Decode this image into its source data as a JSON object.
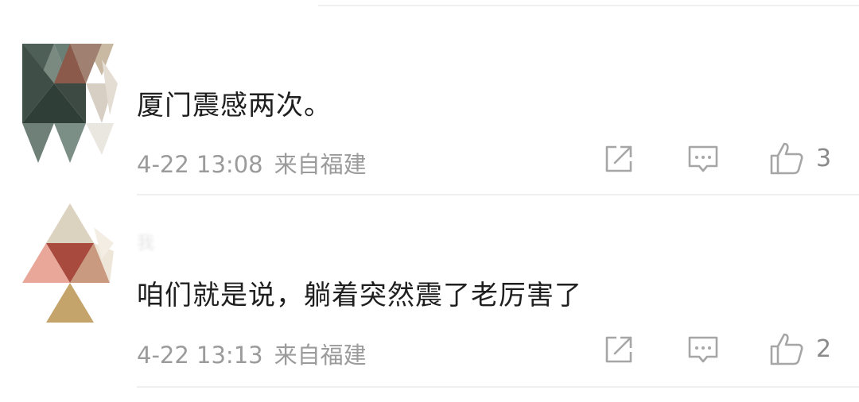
{
  "comments": [
    {
      "username": "",
      "text": "厦门震感两次。",
      "time": "4-22 13:08",
      "location": "来自福建",
      "like_count": "3"
    },
    {
      "username": "我",
      "text": "咱们就是说，躺着突然震了老厉害了",
      "time": "4-22 13:13",
      "location": "来自福建",
      "like_count": "2"
    }
  ],
  "icons": {
    "share": "share-icon",
    "reply": "comment-icon",
    "like": "thumbs-up-icon"
  },
  "colors": {
    "text": "#1f1f1f",
    "meta": "#9b9b9b",
    "icon": "#a6a6a6",
    "divider": "#efefef"
  }
}
